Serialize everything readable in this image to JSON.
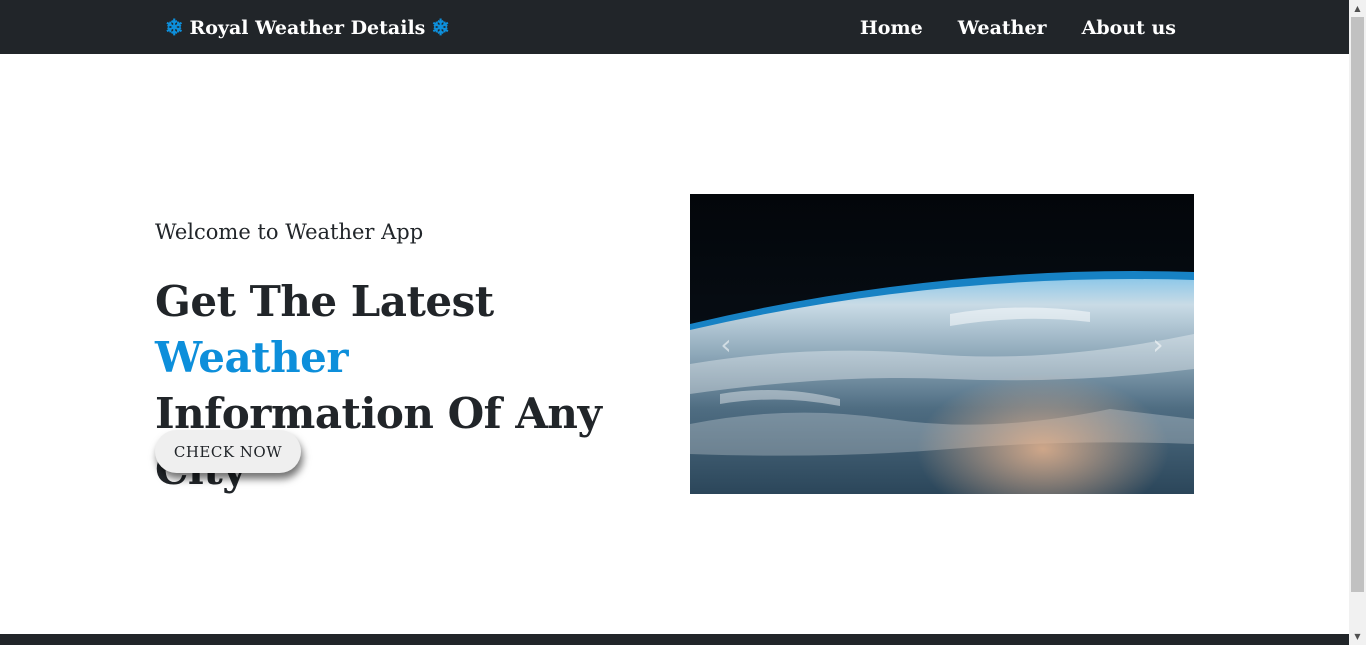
{
  "navbar": {
    "brand": {
      "icon_left": "❄",
      "title": "Royal Weather Details",
      "icon_right": "❄",
      "icon_name": "snowflake-icon"
    },
    "links": [
      {
        "label": "Home"
      },
      {
        "label": "Weather"
      },
      {
        "label": "About us"
      }
    ]
  },
  "hero": {
    "welcome": "Welcome to Weather App",
    "headline_part1": "Get The Latest ",
    "headline_accent": "Weather",
    "headline_part2": "Information Of Any City",
    "cta_label": "CHECK NOW"
  },
  "carousel": {
    "image": "earth-from-space-image",
    "prev_icon": "‹",
    "next_icon": "›"
  },
  "colors": {
    "navbar_bg": "#212529",
    "accent": "#0d8fdb",
    "text": "#212529"
  }
}
